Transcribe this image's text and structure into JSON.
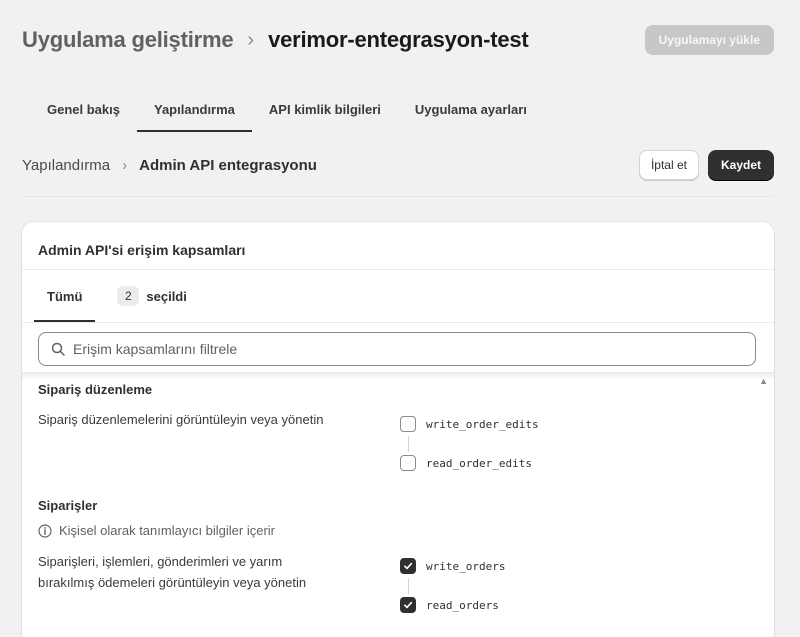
{
  "header": {
    "parent": "Uygulama geliştirme",
    "separator": "›",
    "current": "verimor-entegrasyon-test",
    "upload_label": "Uygulamayı yükle"
  },
  "tabs": [
    {
      "label": "Genel bakış",
      "active": false
    },
    {
      "label": "Yapılandırma",
      "active": true
    },
    {
      "label": "API kimlik bilgileri",
      "active": false
    },
    {
      "label": "Uygulama ayarları",
      "active": false
    }
  ],
  "subheader": {
    "parent": "Yapılandırma",
    "separator": "›",
    "current": "Admin API entegrasyonu",
    "cancel_label": "İptal et",
    "save_label": "Kaydet"
  },
  "card": {
    "title": "Admin API'si erişim kapsamları",
    "tabs": {
      "all_label": "Tümü",
      "selected_count": "2",
      "selected_label": "seçildi"
    },
    "search": {
      "placeholder": "Erişim kapsamlarını filtrele",
      "icon": "search-icon"
    },
    "groups": [
      {
        "title": "Sipariş düzenleme",
        "description": "Sipariş düzenlemelerini görüntüleyin veya yönetin",
        "scopes": [
          {
            "label": "write_order_edits",
            "checked": false
          },
          {
            "label": "read_order_edits",
            "checked": false
          }
        ]
      },
      {
        "title": "Siparişler",
        "note": "Kişisel olarak tanımlayıcı bilgiler içerir",
        "note_icon": "info-icon",
        "description_line1": "Siparişleri, işlemleri, gönderimleri ve yarım",
        "description_line2": "bırakılmış ödemeleri görüntüleyin veya yönetin",
        "scopes": [
          {
            "label": "write_orders",
            "checked": true
          },
          {
            "label": "read_orders",
            "checked": true
          }
        ]
      }
    ]
  },
  "colors": {
    "background": "#f1f1f1",
    "primary_button": "#303030",
    "disabled_button": "#c7c7c7",
    "card": "#ffffff"
  }
}
